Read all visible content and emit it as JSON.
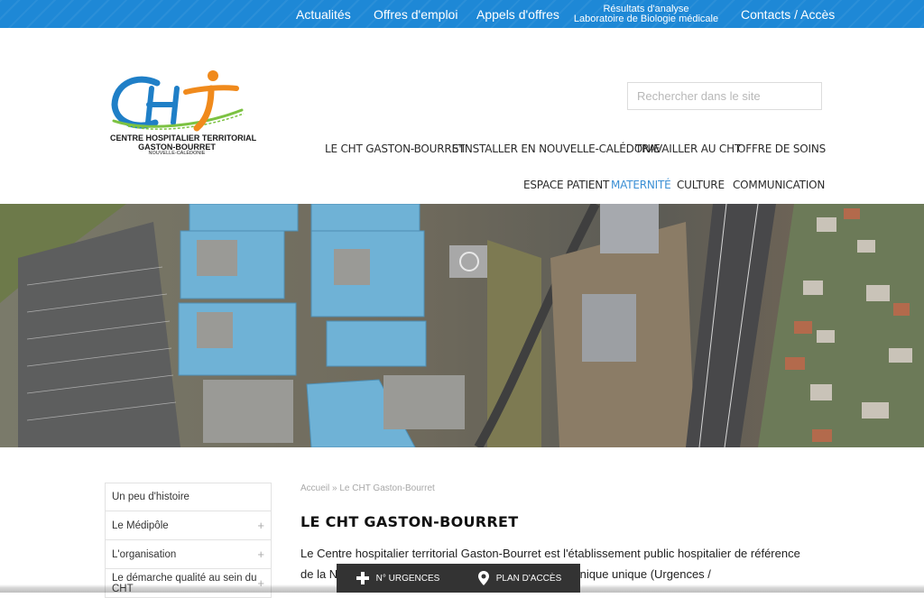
{
  "topnav": {
    "actualites": "Actualités",
    "offres_emploi": "Offres d'emploi",
    "appels_offres": "Appels d'offres",
    "resultats_line1": "Résultats d'analyse",
    "resultats_line2": "Laboratoire de Biologie médicale",
    "contacts": "Contacts / Accès"
  },
  "logo": {
    "line1": "CENTRE HOSPITALIER TERRITORIAL",
    "line2": "GASTON-BOURRET",
    "line3": "NOUVELLE-CALÉDONIE"
  },
  "search": {
    "placeholder": "Rechercher dans le site"
  },
  "mainnav": {
    "row1": [
      "LE CHT GASTON-BOURRET",
      "S'INSTALLER EN NOUVELLE-CALÉDONIE",
      "TRAVAILLER AU CHT",
      "OFFRE DE SOINS"
    ],
    "row2": [
      "ESPACE PATIENT",
      "MATERNITÉ",
      "CULTURE",
      "COMMUNICATION"
    ],
    "active": "MATERNITÉ"
  },
  "sidebar": {
    "items": [
      {
        "label": "Un peu d'histoire",
        "expandable": false
      },
      {
        "label": "Le Médipôle",
        "expandable": true,
        "icon": "+"
      },
      {
        "label": "L'organisation",
        "expandable": true,
        "icon": "+"
      },
      {
        "label": "Le démarche qualité au sein du CHT",
        "expandable": true,
        "icon": "+"
      }
    ]
  },
  "breadcrumb": {
    "home": "Accueil",
    "sep": "»",
    "current": "Le CHT Gaston-Bourret"
  },
  "content": {
    "title": "LE CHT GASTON-BOURRET",
    "paragraph": "Le Centre hospitalier territorial Gaston-Bourret est l'établissement public hospitalier de référence de la Nouvelle-Calédonie. Il dispose d'un plateau technique unique (Urgences /"
  },
  "bottombar": {
    "urgences": "N° URGENCES",
    "plan": "PLAN D'ACCÈS"
  },
  "colors": {
    "topbar": "#1e88d6",
    "nav_active": "#3b8fd4",
    "logo_blue": "#1f7fc7",
    "logo_orange": "#f08a1c",
    "logo_green": "#7cc242",
    "bottombar": "#333333"
  },
  "icons": {
    "urgences": "plus-cross-icon",
    "plan": "map-pin-icon",
    "sidebar_expand": "plus-icon"
  }
}
